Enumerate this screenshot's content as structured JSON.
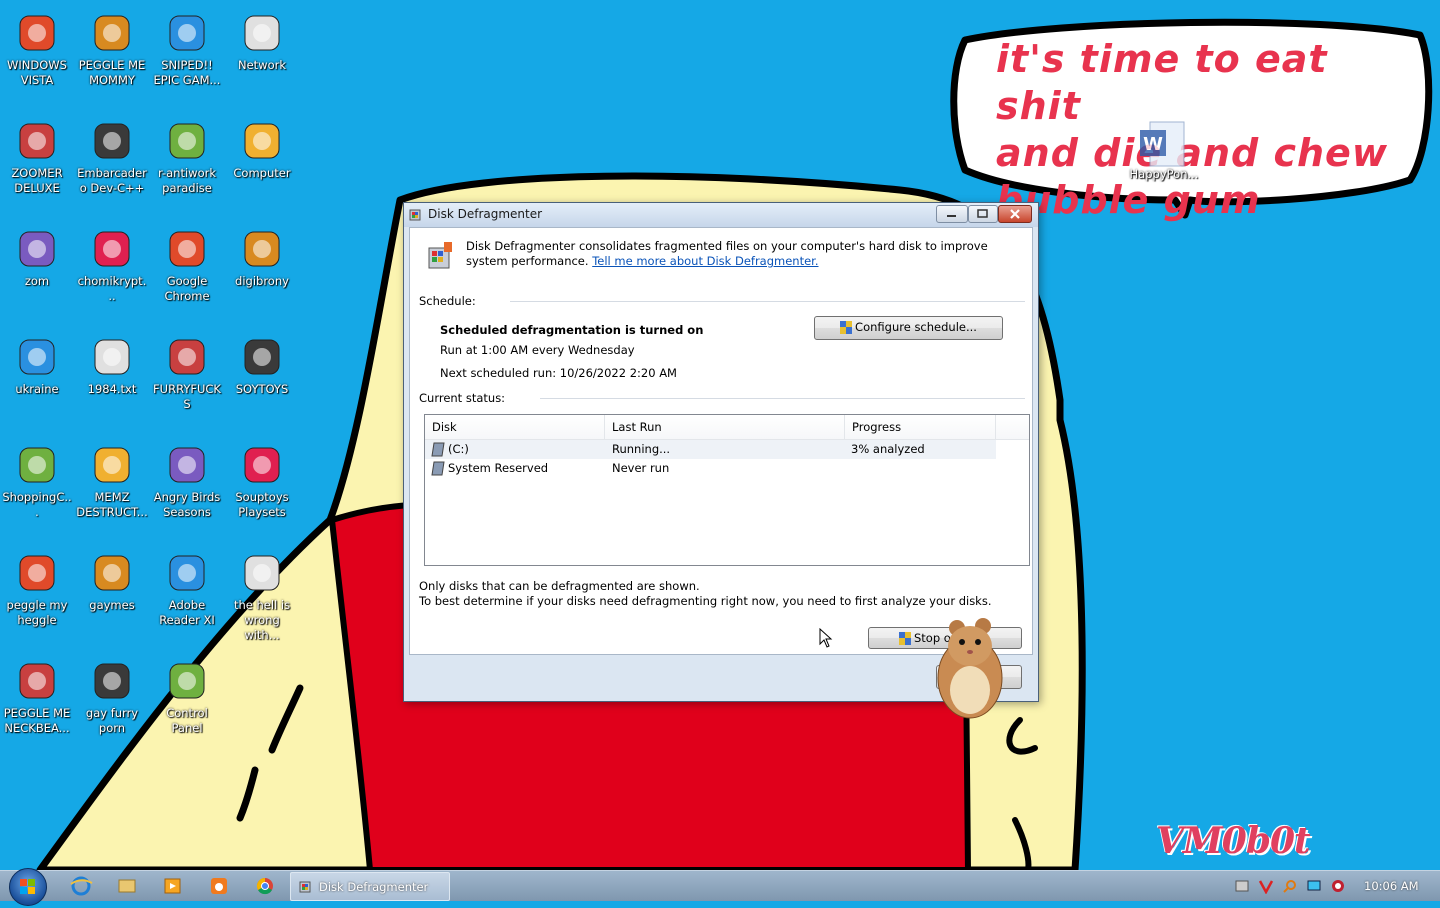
{
  "desktop": {
    "icons": [
      {
        "label": "WINDOWS VISTA"
      },
      {
        "label": "PEGGLE ME MOMMY"
      },
      {
        "label": "SNIPED!! EPIC GAM..."
      },
      {
        "label": "Network"
      },
      {
        "label": "ZOOMER DELUXE"
      },
      {
        "label": "Embarcadero Dev-C++"
      },
      {
        "label": "r-antiwork paradise"
      },
      {
        "label": "Computer"
      },
      {
        "label": "zom"
      },
      {
        "label": "chomikrypt..."
      },
      {
        "label": "Google Chrome"
      },
      {
        "label": "digibrony"
      },
      {
        "label": "ukraine"
      },
      {
        "label": "1984.txt"
      },
      {
        "label": "FURRYFUCKS"
      },
      {
        "label": "SOYTOYS"
      },
      {
        "label": "ShoppingC..."
      },
      {
        "label": "MEMZ DESTRUCT..."
      },
      {
        "label": "Angry Birds Seasons"
      },
      {
        "label": "Souptoys Playsets"
      },
      {
        "label": "peggle my heggle"
      },
      {
        "label": "gaymes"
      },
      {
        "label": "Adobe Reader XI"
      },
      {
        "label": "the hell is wrong with..."
      },
      {
        "label": "PEGGLE ME NECKBEA..."
      },
      {
        "label": "gay furry porn"
      },
      {
        "label": "Control Panel"
      }
    ],
    "floating_icon": {
      "label": "HappyPon..."
    },
    "wallpaper": {
      "bubble_lines": [
        "it's time to eat shit",
        "and die and chew",
        "bubble gum"
      ],
      "signature": "VM0b0t",
      "colors": {
        "sky": "#15a8e6",
        "shirt": "#e0001b",
        "skin": "#fbf4b0",
        "text": "#e8334e"
      }
    }
  },
  "window": {
    "title": "Disk Defragmenter",
    "intro_text": "Disk Defragmenter consolidates fragmented files on your computer's hard disk to improve system performance.",
    "intro_link": "Tell me more about Disk Defragmenter.",
    "schedule_label": "Schedule:",
    "schedule_status": "Scheduled defragmentation is turned on",
    "schedule_run": "Run at 1:00 AM every Wednesday",
    "schedule_next": "Next scheduled run: 10/26/2022 2:20 AM",
    "configure_button": "Configure schedule...",
    "current_status_label": "Current status:",
    "columns": [
      "Disk",
      "Last Run",
      "Progress"
    ],
    "disks": [
      {
        "disk": "(C:)",
        "last_run": "Running...",
        "progress": "3% analyzed"
      },
      {
        "disk": "System Reserved",
        "last_run": "Never run",
        "progress": ""
      }
    ],
    "note_line1": "Only disks that can be defragmented are shown.",
    "note_line2": "To best determine if your disks need defragmenting right now, you need to first analyze your disks.",
    "stop_button": "Stop o",
    "close_button": ""
  },
  "taskbar": {
    "active_task": "Disk Defragmenter",
    "clock": "10:06 AM",
    "pinned": [
      "internet-explorer",
      "windows-explorer",
      "media-player",
      "uc-browser",
      "chrome"
    ]
  }
}
